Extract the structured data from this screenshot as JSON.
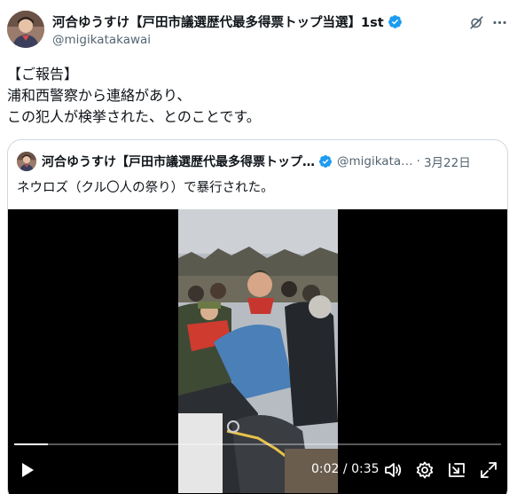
{
  "post": {
    "author": {
      "display_name": "河合ゆうすけ【戸田市議選歴代最多得票トップ当選】1st",
      "handle": "@migikatakawai",
      "verified": true
    },
    "body_lines": [
      "【ご報告】",
      "浦和西警察から連絡があり、",
      "この犯人が検挙された、とのことです。"
    ],
    "icons": {
      "grok": "grok-icon",
      "more": "more-options-icon",
      "verified": "verified-badge-icon"
    }
  },
  "quote": {
    "author": {
      "display_name": "河合ゆうすけ【戸田市議選歴代最多得票トップ…",
      "handle": "@migikata…",
      "verified": true
    },
    "separator": "·",
    "date": "3月22日",
    "text": "ネウロズ（クル〇人の祭り）で暴行された。"
  },
  "video": {
    "current_time": "0:02",
    "time_separator": "/",
    "duration": "0:35",
    "progress_fraction": 0.07,
    "controls": [
      "play-icon",
      "volume-icon",
      "settings-icon",
      "pip-icon",
      "fullscreen-icon"
    ]
  },
  "colors": {
    "text_primary": "#0f1419",
    "text_secondary": "#536471",
    "verified_blue": "#1d9bf0",
    "border": "#cfd9de"
  }
}
